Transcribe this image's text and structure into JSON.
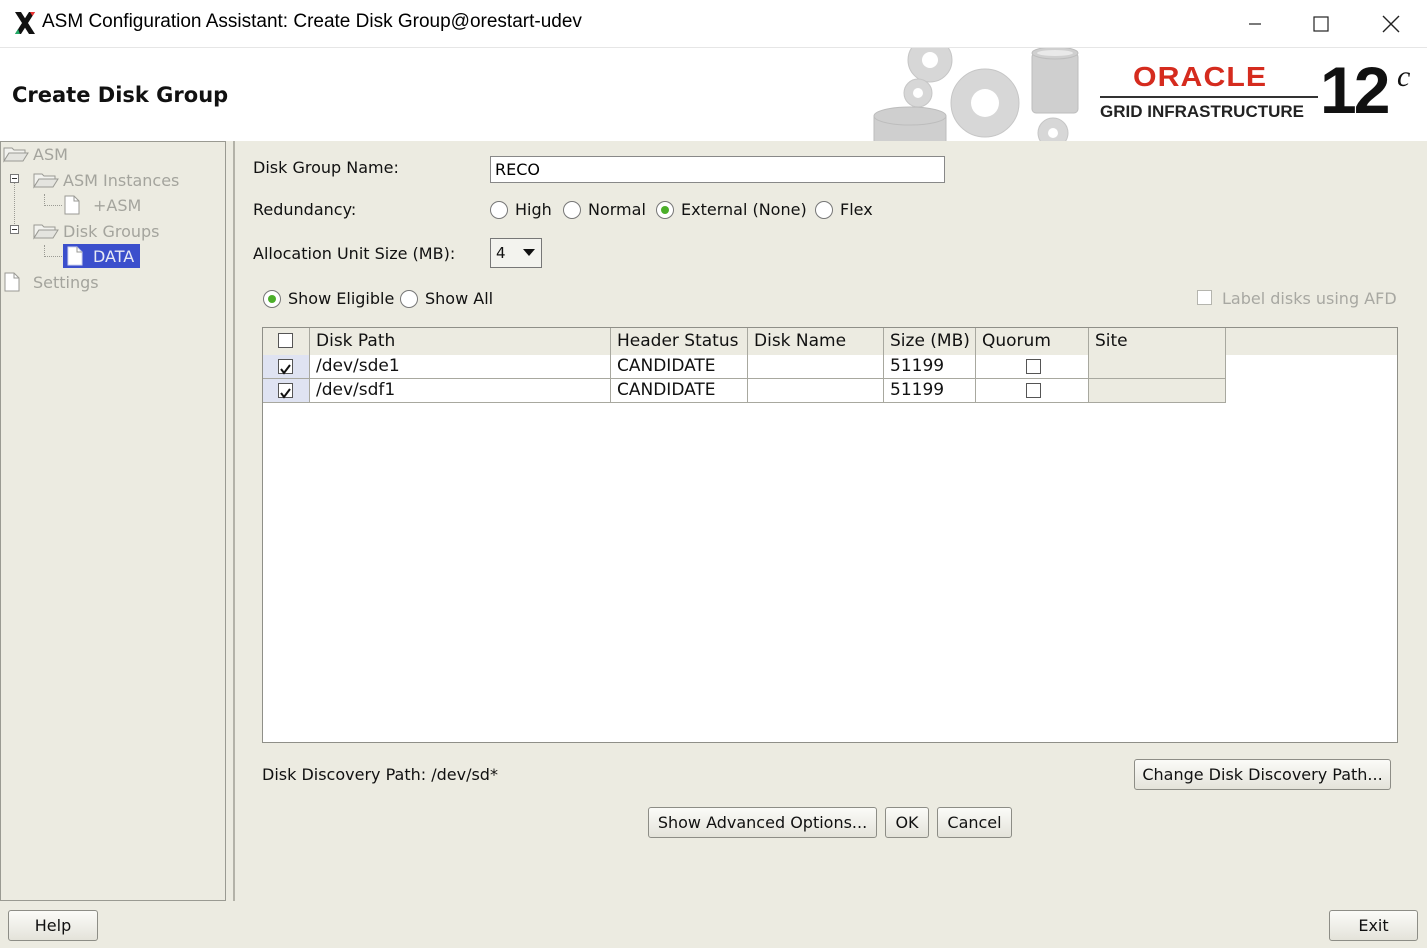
{
  "window": {
    "title": "ASM Configuration Assistant: Create Disk Group@orestart-udev",
    "icons": [
      "x-logo-icon",
      "minimize-icon",
      "maximize-icon",
      "close-icon"
    ]
  },
  "header": {
    "page_title": "Create Disk Group",
    "brand": "ORACLE",
    "product": "GRID INFRASTRUCTURE",
    "version": "12",
    "version_sup": "c",
    "brand_color": "#d52b1e"
  },
  "nav": {
    "items": [
      {
        "label": "ASM"
      },
      {
        "label": "ASM Instances"
      },
      {
        "label": "+ASM"
      },
      {
        "label": "Disk Groups"
      },
      {
        "label": "DATA",
        "selected": true
      },
      {
        "label": "Settings"
      }
    ]
  },
  "form": {
    "dg_name_label": "Disk Group Name:",
    "dg_name_value": "RECO",
    "redundancy_label": "Redundancy:",
    "redundancy_options": [
      "High",
      "Normal",
      "External (None)",
      "Flex"
    ],
    "redundancy_selected": "External (None)",
    "au_label": "Allocation Unit Size (MB):",
    "au_value": "4",
    "show_eligible": "Show Eligible",
    "show_all": "Show All",
    "show_selected": "Show Eligible",
    "afd_label": "Label disks using AFD"
  },
  "table": {
    "columns": [
      "Disk Path",
      "Header Status",
      "Disk Name",
      "Size (MB)",
      "Quorum",
      "Site"
    ],
    "rows": [
      {
        "checked": true,
        "path": "/dev/sde1",
        "status": "CANDIDATE",
        "name": "",
        "size": "51199",
        "quorum": false,
        "site": ""
      },
      {
        "checked": true,
        "path": "/dev/sdf1",
        "status": "CANDIDATE",
        "name": "",
        "size": "51199",
        "quorum": false,
        "site": ""
      }
    ]
  },
  "discovery": {
    "label": "Disk Discovery Path: /dev/sd*",
    "change_button": "Change Disk Discovery Path..."
  },
  "buttons": {
    "advanced": "Show Advanced Options...",
    "ok": "OK",
    "cancel": "Cancel",
    "help": "Help",
    "exit": "Exit"
  }
}
